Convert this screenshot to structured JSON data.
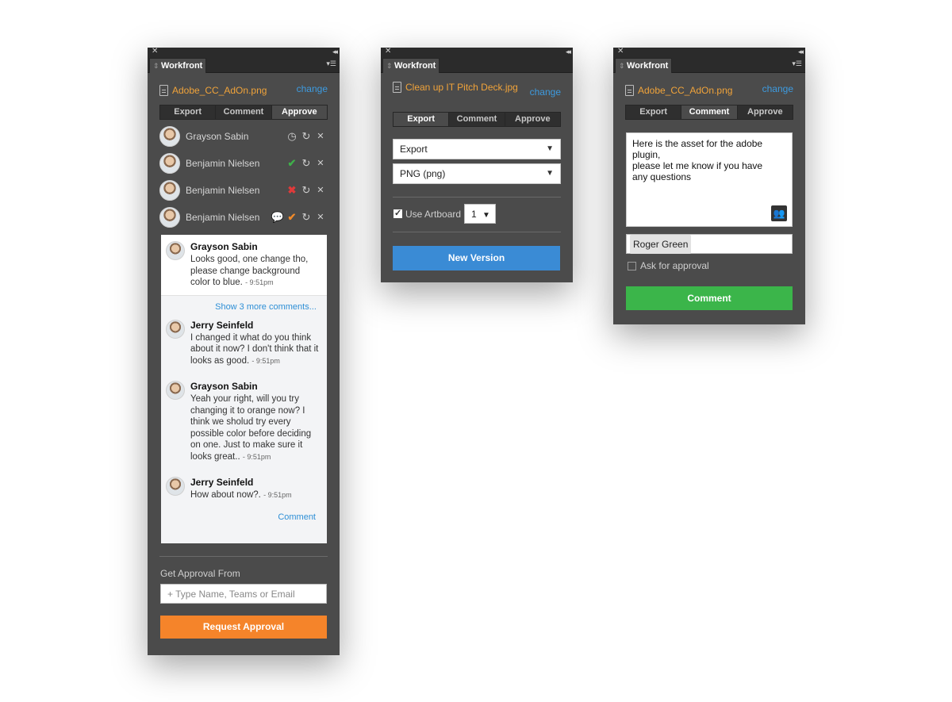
{
  "panel1": {
    "title": "Workfront",
    "file_name": "Adobe_CC_AdOn.png",
    "change": "change",
    "tabs": [
      "Export",
      "Comment",
      "Approve"
    ],
    "active_tab": "Approve",
    "approvers": [
      {
        "name": "Grayson Sabin",
        "status": "pending"
      },
      {
        "name": "Benjamin Nielsen",
        "status": "approved"
      },
      {
        "name": "Benjamin Nielsen",
        "status": "rejected"
      },
      {
        "name": "Benjamin Nielsen",
        "status": "approved-with-comment"
      }
    ],
    "comments": {
      "first": {
        "author": "Grayson Sabin",
        "text": "Looks good, one change tho, please change background color to blue.",
        "time": "- 9:51pm"
      },
      "show_more": "Show 3 more comments...",
      "items": [
        {
          "author": "Jerry Seinfeld",
          "text": "I changed it what do you think about it now? I don't think that it looks as good.",
          "time": "- 9:51pm"
        },
        {
          "author": "Grayson Sabin",
          "text": "Yeah your right, will you try changing it to orange now? I think we sholud try every possible color before deciding on one. Just to make sure it looks great..",
          "time": "- 9:51pm"
        },
        {
          "author": "Jerry Seinfeld",
          "text": "How about now?.",
          "time": "- 9:51pm"
        }
      ],
      "comment_link": "Comment"
    },
    "approval_label": "Get Approval From",
    "approval_placeholder": "+ Type Name, Teams or Email",
    "request_button": "Request Approval",
    "colors": {
      "orange": "#f5842a"
    }
  },
  "panel2": {
    "title": "Workfront",
    "file_name": "Clean up IT Pitch Deck.jpg",
    "change": "change",
    "tabs": [
      "Export",
      "Comment",
      "Approve"
    ],
    "active_tab": "Export",
    "select_action": "Export",
    "select_format": "PNG (png)",
    "use_artboard_label": "Use Artboard",
    "use_artboard_checked": true,
    "artboard_value": "1",
    "button": "New Version",
    "colors": {
      "blue": "#3a8bd5"
    }
  },
  "panel3": {
    "title": "Workfront",
    "file_name": "Adobe_CC_AdOn.png",
    "change": "change",
    "tabs": [
      "Export",
      "Comment",
      "Approve"
    ],
    "active_tab": "Comment",
    "comment_text_lines": [
      "Here is the asset for the adobe plugin,",
      "please let me know if you have",
      "any questions"
    ],
    "recipient": "Roger Green",
    "ask_approval_label": "Ask for approval",
    "ask_approval_checked": false,
    "button": "Comment",
    "colors": {
      "green": "#3bb54a"
    }
  }
}
